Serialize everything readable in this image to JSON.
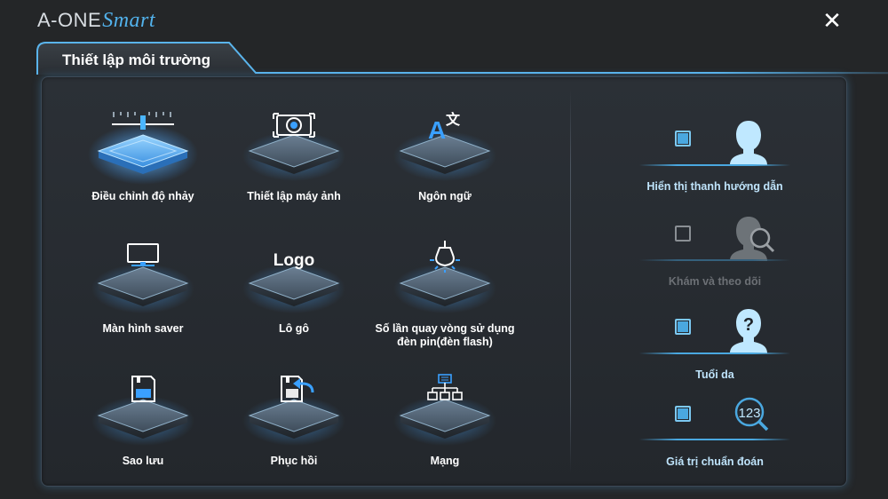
{
  "app": {
    "brand_main": "A-ONE",
    "brand_accent": "Smart",
    "close_label": "✕"
  },
  "tab": {
    "title": "Thiết lập môi trường"
  },
  "colors": {
    "accent": "#4aa8e0",
    "background": "#242628",
    "label_light": "#bfe4fb",
    "label_disabled": "#6c7075"
  },
  "tiles": [
    {
      "label": "Điều chỉnh độ nhảy",
      "icon": "sensitivity-ruler-icon",
      "active": true
    },
    {
      "label": "Thiết lập máy ảnh",
      "icon": "camera-icon",
      "active": false
    },
    {
      "label": "Ngôn ngữ",
      "icon": "translate-icon",
      "active": false
    },
    {
      "label": "Màn hình saver",
      "icon": "monitor-icon",
      "active": false
    },
    {
      "label": "Lô gô",
      "icon": "logo-icon",
      "active": false,
      "icon_text": "Logo"
    },
    {
      "label": "Số lần quay vòng sử dụng đèn pin(đèn flash)",
      "icon": "light-bulb-icon",
      "active": false
    },
    {
      "label": "Sao lưu",
      "icon": "backup-save-icon",
      "active": false
    },
    {
      "label": "Phục hồi",
      "icon": "restore-icon",
      "active": false
    },
    {
      "label": "Mạng",
      "icon": "network-icon",
      "active": false
    }
  ],
  "options": [
    {
      "label": "Hiển thị thanh hướng dẫn",
      "checked": true,
      "enabled": true,
      "icon": "user-silhouette-icon"
    },
    {
      "label": "Khám và theo dõi",
      "checked": false,
      "enabled": false,
      "icon": "user-search-icon"
    },
    {
      "label": "Tuổi da",
      "checked": true,
      "enabled": true,
      "icon": "user-question-icon",
      "icon_text": "?"
    },
    {
      "label": "Giá trị chuẩn đoán",
      "checked": true,
      "enabled": true,
      "icon": "number-search-icon",
      "icon_text": "123"
    }
  ]
}
